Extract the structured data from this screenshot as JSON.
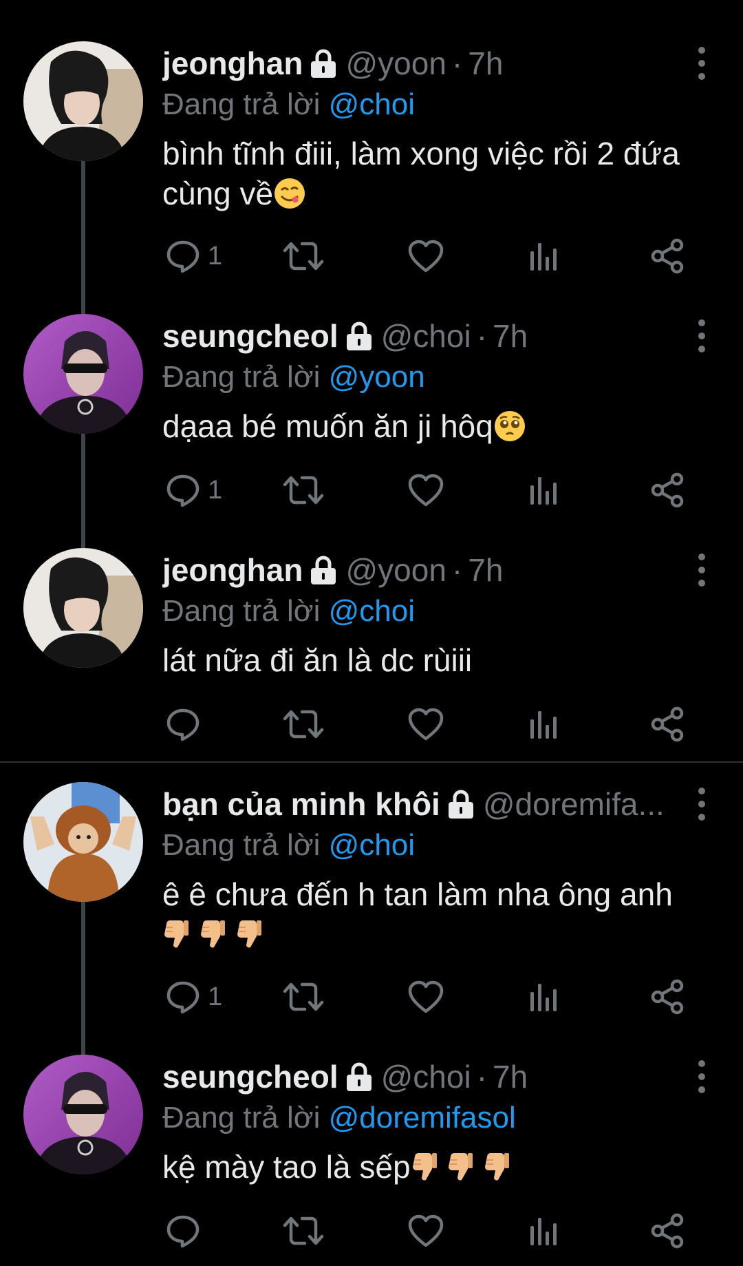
{
  "tweets": [
    {
      "name": "jeonghan",
      "handle": "@yoon",
      "time": "7h",
      "replying_label": "Đang trả lời",
      "replying_to": "@choi",
      "text": "bình tĩnh điii, làm xong việc rồi 2 đứa cùng về",
      "emoji": "savoring-face",
      "reply_count": "1"
    },
    {
      "name": "seungcheol",
      "handle": "@choi",
      "time": "7h",
      "replying_label": "Đang trả lời",
      "replying_to": "@yoon",
      "text": "dạaa bé muốn ăn ji hôq",
      "emoji": "pleading-face",
      "reply_count": "1"
    },
    {
      "name": "jeonghan",
      "handle": "@yoon",
      "time": "7h",
      "replying_label": "Đang trả lời",
      "replying_to": "@choi",
      "text": "lát nữa đi ăn là dc rùiii",
      "reply_count": ""
    },
    {
      "name": "bạn của minh khôi",
      "handle": "@doremifa...",
      "time": "",
      "replying_label": "Đang trả lời",
      "replying_to": "@choi",
      "text": "ê ê chưa đến h tan làm nha ông anh",
      "emoji": "thumbs-down x3",
      "reply_count": "1"
    },
    {
      "name": "seungcheol",
      "handle": "@choi",
      "time": "7h",
      "replying_label": "Đang trả lời",
      "replying_to": "@doremifasol",
      "text": "kệ mày tao là sếp",
      "emoji": "thumbs-down x3",
      "reply_count": ""
    }
  ],
  "colors": {
    "background": "#000000",
    "text": "#e7e9ea",
    "secondary": "#71767b",
    "mention": "#1d9bf0",
    "thread_line": "#3f4448"
  },
  "icons": [
    "lock-icon",
    "more-icon",
    "reply-icon",
    "retweet-icon",
    "like-icon",
    "views-icon",
    "share-icon"
  ]
}
